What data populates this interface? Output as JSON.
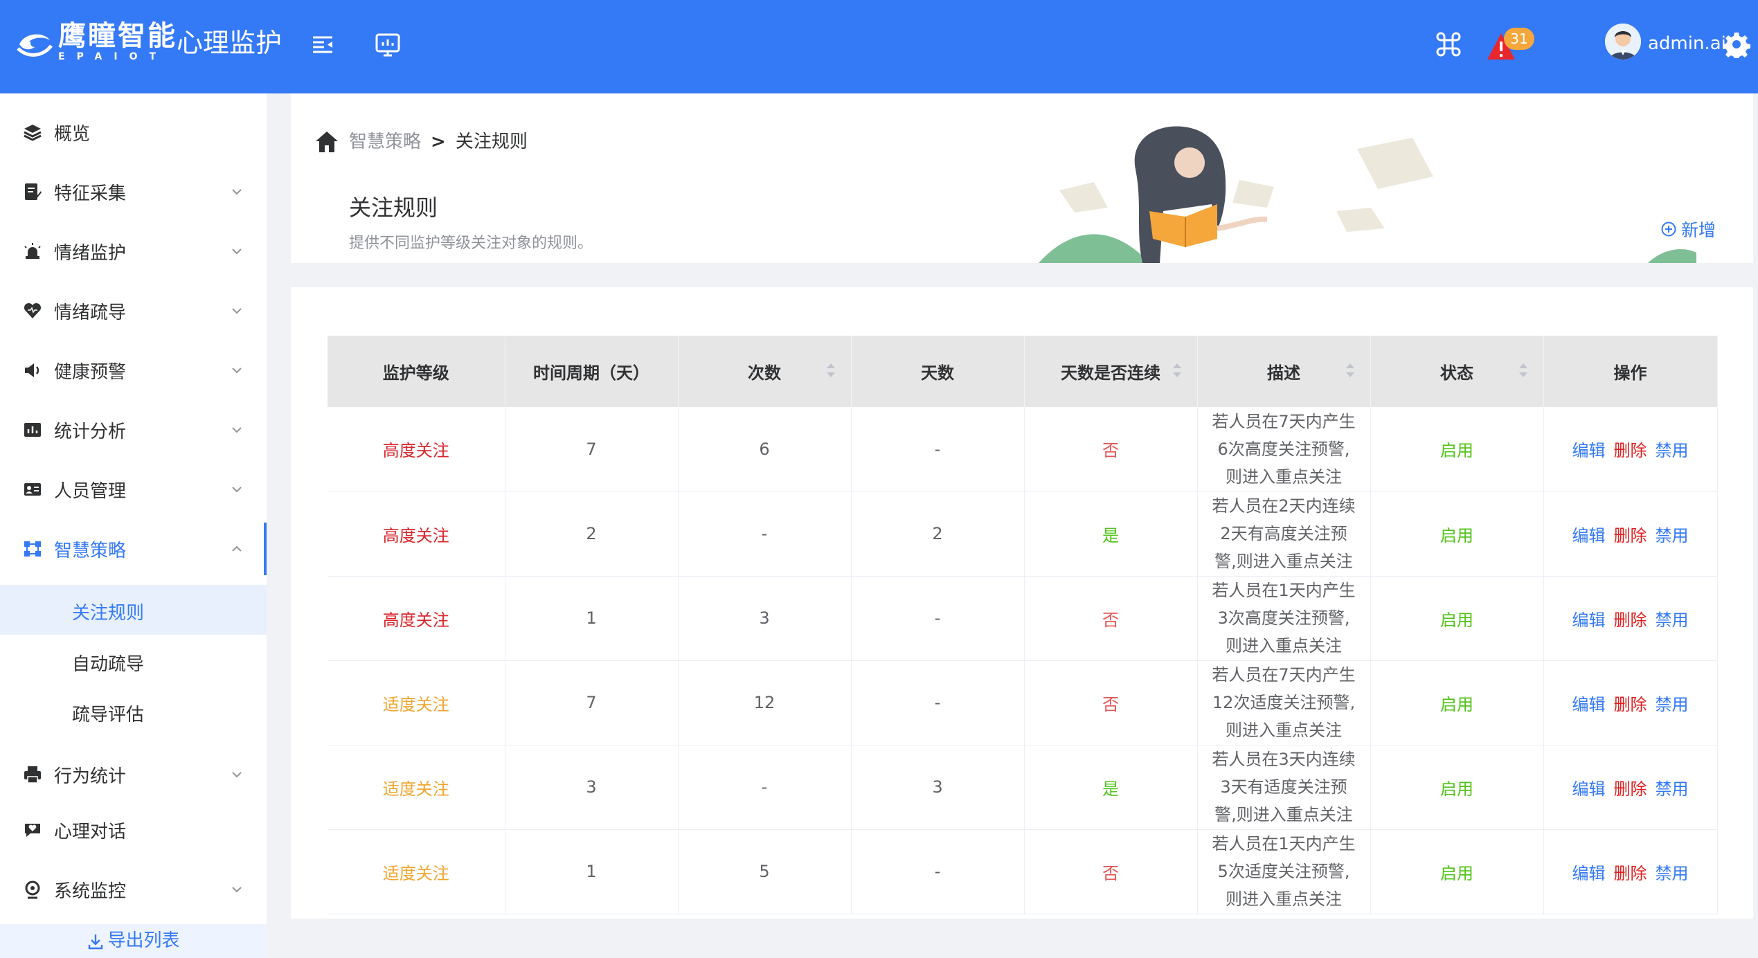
{
  "topbar": {
    "brand_cn": "鹰瞳智能",
    "brand_en": "EPAIOT",
    "app_title": "心理监护",
    "alert_count": "31",
    "username": "admin.ai",
    "bg_color": "#3479f6"
  },
  "sidebar": {
    "items": [
      {
        "label": "概览",
        "icon": "layers-icon"
      },
      {
        "label": "特征采集",
        "icon": "edit-doc-icon"
      },
      {
        "label": "情绪监护",
        "icon": "alarm-light-icon"
      },
      {
        "label": "情绪疏导",
        "icon": "heart-icon"
      },
      {
        "label": "健康预警",
        "icon": "speaker-icon"
      },
      {
        "label": "统计分析",
        "icon": "bar-chart-icon"
      },
      {
        "label": "人员管理",
        "icon": "id-card-icon"
      },
      {
        "label": "智慧策略",
        "icon": "flowchart-icon"
      },
      {
        "label": "行为统计",
        "icon": "printer-icon"
      },
      {
        "label": "心理对话",
        "icon": "chat-heart-icon"
      },
      {
        "label": "系统监控",
        "icon": "location-icon"
      }
    ],
    "sub_items": [
      "关注规则",
      "自动疏导",
      "疏导评估"
    ],
    "export_label": "导出列表"
  },
  "breadcrumb": {
    "parent": "智慧策略",
    "separator": ">",
    "current": "关注规则"
  },
  "page": {
    "title": "关注规则",
    "description": "提供不同监护等级关注对象的规则。",
    "add_label": "新增"
  },
  "table": {
    "columns": [
      "监护等级",
      "时间周期（天）",
      "次数",
      "天数",
      "天数是否连续",
      "描述",
      "状态",
      "操作"
    ],
    "actions": {
      "edit": "编辑",
      "delete": "删除",
      "disable": "禁用"
    },
    "rows": [
      {
        "level": "高度关注",
        "period": "7",
        "count": "6",
        "days": "-",
        "continuous": "否",
        "desc": [
          "若人员在7天内产生",
          "6次高度关注预警,",
          "则进入重点关注"
        ],
        "status": "启用"
      },
      {
        "level": "高度关注",
        "period": "2",
        "count": "-",
        "days": "2",
        "continuous": "是",
        "desc": [
          "若人员在2天内连续",
          "2天有高度关注预",
          "警,则进入重点关注"
        ],
        "status": "启用"
      },
      {
        "level": "高度关注",
        "period": "1",
        "count": "3",
        "days": "-",
        "continuous": "否",
        "desc": [
          "若人员在1天内产生",
          "3次高度关注预警,",
          "则进入重点关注"
        ],
        "status": "启用"
      },
      {
        "level": "适度关注",
        "period": "7",
        "count": "12",
        "days": "-",
        "continuous": "否",
        "desc": [
          "若人员在7天内产生",
          "12次适度关注预警,",
          "则进入重点关注"
        ],
        "status": "启用"
      },
      {
        "level": "适度关注",
        "period": "3",
        "count": "-",
        "days": "3",
        "continuous": "是",
        "desc": [
          "若人员在3天内连续",
          "3天有适度关注预",
          "警,则进入重点关注"
        ],
        "status": "启用"
      },
      {
        "level": "适度关注",
        "period": "1",
        "count": "5",
        "days": "-",
        "continuous": "否",
        "desc": [
          "若人员在1天内产生",
          "5次适度关注预警,",
          "则进入重点关注"
        ],
        "status": "启用"
      }
    ]
  }
}
